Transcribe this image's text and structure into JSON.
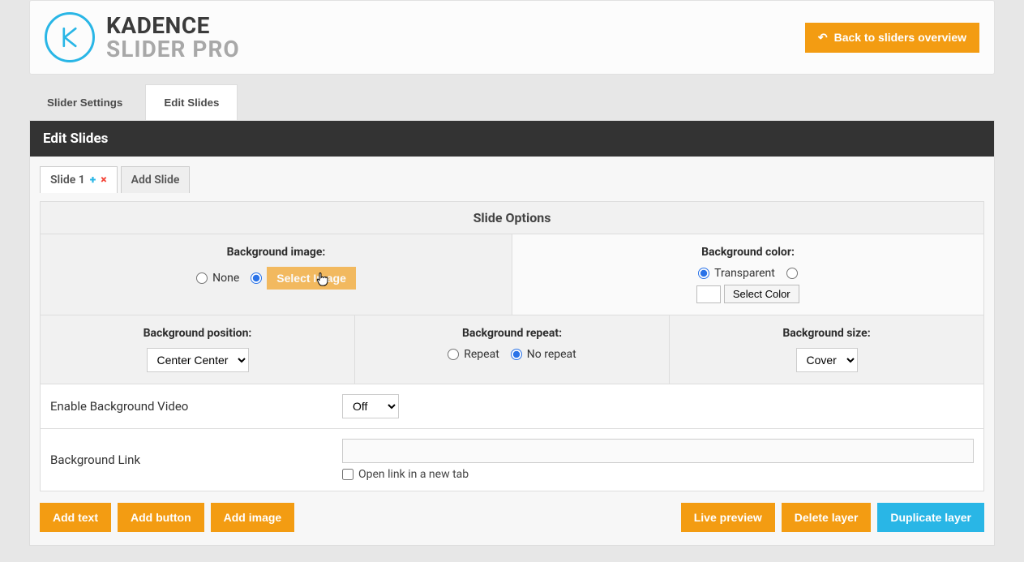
{
  "brand": {
    "top": "KADENCE",
    "bottom": "SLIDER PRO"
  },
  "header": {
    "back_btn": "Back to sliders overview"
  },
  "tabs": {
    "settings": "Slider Settings",
    "edit": "Edit Slides"
  },
  "panel_title": "Edit Slides",
  "slide_tabs": {
    "slide1": "Slide 1",
    "add": "Add Slide"
  },
  "options": {
    "title": "Slide Options",
    "bg_image": {
      "label": "Background image:",
      "none": "None",
      "select_btn": "Select Image"
    },
    "bg_color": {
      "label": "Background color:",
      "transparent": "Transparent",
      "select_btn": "Select Color"
    },
    "bg_position": {
      "label": "Background position:",
      "value": "Center Center"
    },
    "bg_repeat": {
      "label": "Background repeat:",
      "repeat": "Repeat",
      "norepeat": "No repeat"
    },
    "bg_size": {
      "label": "Background size:",
      "value": "Cover"
    },
    "video": {
      "label": "Enable Background Video",
      "value": "Off"
    },
    "link": {
      "label": "Background Link",
      "open_new": "Open link in a new tab"
    }
  },
  "footer": {
    "add_text": "Add text",
    "add_button": "Add button",
    "add_image": "Add image",
    "live_preview": "Live preview",
    "delete_layer": "Delete layer",
    "duplicate_layer": "Duplicate layer"
  }
}
